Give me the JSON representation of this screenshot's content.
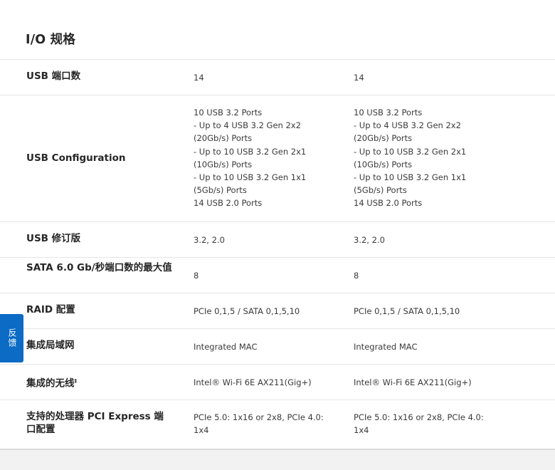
{
  "section": {
    "title": "I/O 规格"
  },
  "rows": [
    {
      "label": "USB 端口数",
      "col1": "14",
      "col2": "14"
    },
    {
      "label": "USB Configuration",
      "col1": "10 USB 3.2 Ports\n- Up to 4 USB 3.2 Gen 2x2\n(20Gb/s) Ports\n- Up to 10 USB 3.2 Gen 2x1\n(10Gb/s) Ports\n- Up to 10 USB 3.2 Gen 1x1\n(5Gb/s) Ports\n14 USB 2.0 Ports",
      "col2": "10 USB 3.2 Ports\n- Up to 4 USB 3.2 Gen 2x2\n(20Gb/s) Ports\n- Up to 10 USB 3.2 Gen 2x1\n(10Gb/s) Ports\n- Up to 10 USB 3.2 Gen 1x1\n(5Gb/s) Ports\n14 USB 2.0 Ports"
    },
    {
      "label": "USB 修订版",
      "col1": "3.2, 2.0",
      "col2": "3.2, 2.0"
    },
    {
      "label": "SATA 6.0 Gb/秒端口数的最大值",
      "col1": "8",
      "col2": "8"
    },
    {
      "label": "RAID 配置",
      "col1": "PCIe 0,1,5 / SATA 0,1,5,10",
      "col2": "PCIe 0,1,5 / SATA 0,1,5,10"
    },
    {
      "label": "集成局域网",
      "col1": "Integrated MAC",
      "col2": "Integrated MAC"
    },
    {
      "label": "集成的无线",
      "label_sup": "‡",
      "col1": "Intel® Wi-Fi 6E AX211(Gig+)",
      "col2": "Intel® Wi-Fi 6E AX211(Gig+)"
    },
    {
      "label": "支持的处理器 PCI Express 端口配置",
      "col1": "PCIe 5.0: 1x16 or 2x8, PCIe 4.0:\n1x4",
      "col2": "PCIe 5.0: 1x16 or 2x8, PCIe 4.0:\n1x4"
    }
  ],
  "feedback": {
    "label": "反馈"
  }
}
